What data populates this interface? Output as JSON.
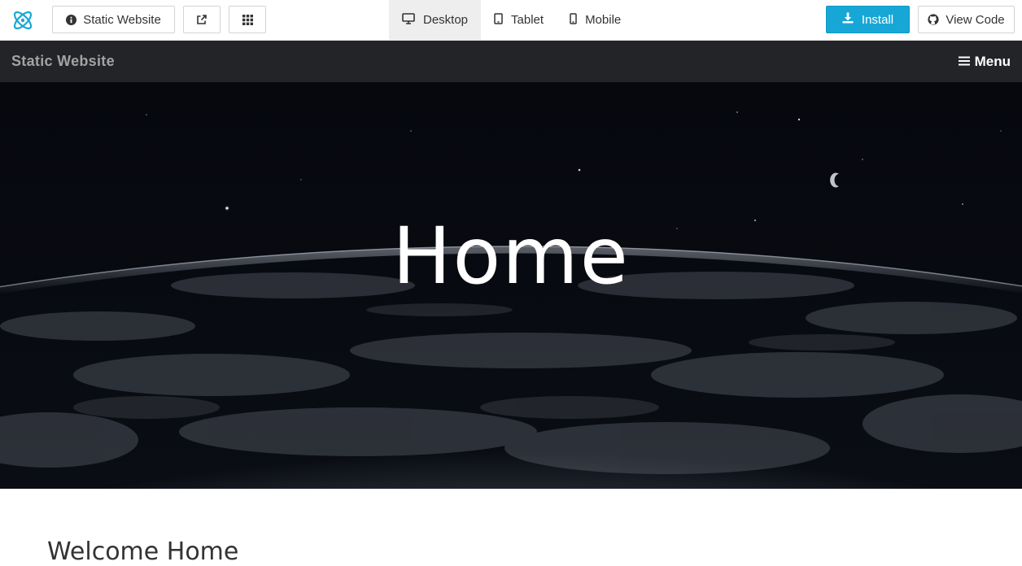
{
  "toolbar": {
    "site_button_label": "Static Website",
    "devices": [
      {
        "label": "Desktop",
        "icon": "desktop-icon",
        "active": true
      },
      {
        "label": "Tablet",
        "icon": "tablet-icon",
        "active": false
      },
      {
        "label": "Mobile",
        "icon": "mobile-icon",
        "active": false
      }
    ],
    "install_label": "Install",
    "view_code_label": "View Code",
    "accent_color": "#17a7d6"
  },
  "site": {
    "brand": "Static Website",
    "menu_label": "Menu",
    "hero_title": "Home",
    "section_heading": "Welcome Home"
  }
}
